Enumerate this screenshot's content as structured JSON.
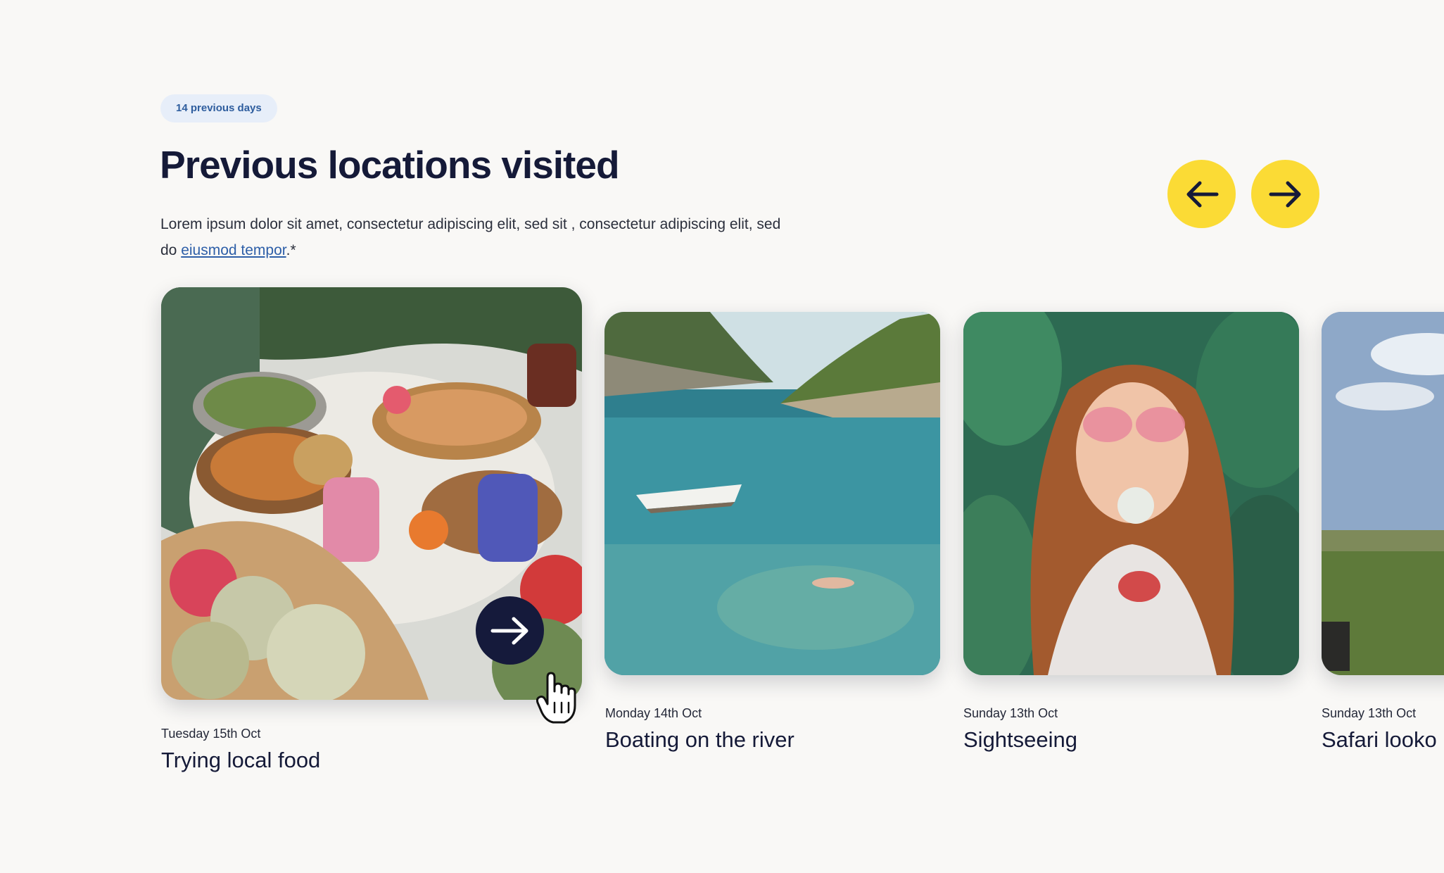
{
  "badge": "14 previous days",
  "heading": "Previous locations visited",
  "description": {
    "text_before": "Lorem ipsum dolor sit amet, consectetur adipiscing elit, sed sit , consectetur adipiscing elit, sed do ",
    "link_text": "eiusmod tempor",
    "text_after": ".*"
  },
  "navigation": {
    "prev_icon": "arrow-left-icon",
    "next_icon": "arrow-right-icon",
    "button_color": "#fbdb35"
  },
  "cards": [
    {
      "date": "Tuesday 15th Oct",
      "title": "Trying local food",
      "image": "food-table-photo",
      "active": true
    },
    {
      "date": "Monday 14th Oct",
      "title": "Boating on the river",
      "image": "river-boat-photo"
    },
    {
      "date": "Sunday 13th Oct",
      "title": "Sightseeing",
      "image": "woman-dandelion-photo"
    },
    {
      "date": "Sunday 13th Oct",
      "title": "Safari looko",
      "image": "safari-landscape-photo"
    }
  ],
  "colors": {
    "background": "#f9f8f6",
    "heading": "#151a38",
    "badge_bg": "#e7eef9",
    "badge_text": "#2e5d9e",
    "link": "#2e5fa8",
    "card_button": "#151a3b"
  }
}
